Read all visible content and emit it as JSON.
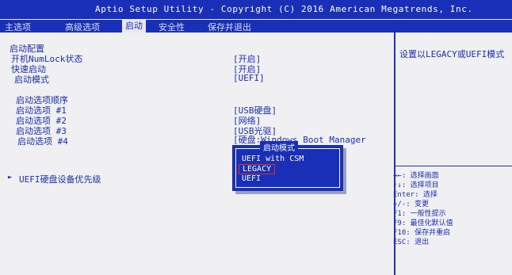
{
  "title": "Aptio Setup Utility - Copyright (C) 2016 American Megatrends, Inc.",
  "tabs": [
    {
      "label": "主选项"
    },
    {
      "label": "高级选项"
    },
    {
      "label": "启动"
    },
    {
      "label": "安全性"
    },
    {
      "label": "保存并退出"
    }
  ],
  "main": {
    "section1": "启动配置",
    "numlock_label": "开机NumLock状态",
    "numlock_value": "[开启]",
    "fastboot_label": "快速启动",
    "fastboot_value": "[开启]",
    "bootmode_label": "启动模式",
    "bootmode_value": "[UEFI]",
    "section2": "启动选项顺序",
    "boot_options": [
      {
        "label": "启动选项 #1",
        "value": "[USB硬盘]"
      },
      {
        "label": "启动选项 #2",
        "value": "[网络]"
      },
      {
        "label": "启动选项 #3",
        "value": "[USB光驱]"
      },
      {
        "label": "启动选项 #4",
        "value": "[硬盘:Windows Boot Manager"
      }
    ],
    "uefi_priority": "UEFI硬盘设备优先级"
  },
  "popup": {
    "title": "启动模式",
    "options": [
      "UEFI with CSM",
      "LEGACY",
      "UEFI"
    ],
    "selected": "LEGACY"
  },
  "help": {
    "text": "设置以LEGACY或UEFI模式"
  },
  "keys": [
    "→←: 选择画面",
    "↑↓: 选择项目",
    "Enter: 选择",
    "+/-: 变更",
    "F1: 一般性提示",
    "F9: 最佳化默认值",
    "F10: 保存并重启",
    "ESC: 退出"
  ],
  "colors": {
    "accent": "#1a2fb8",
    "background": "#f0f0f3",
    "selection_border": "#e03020"
  }
}
